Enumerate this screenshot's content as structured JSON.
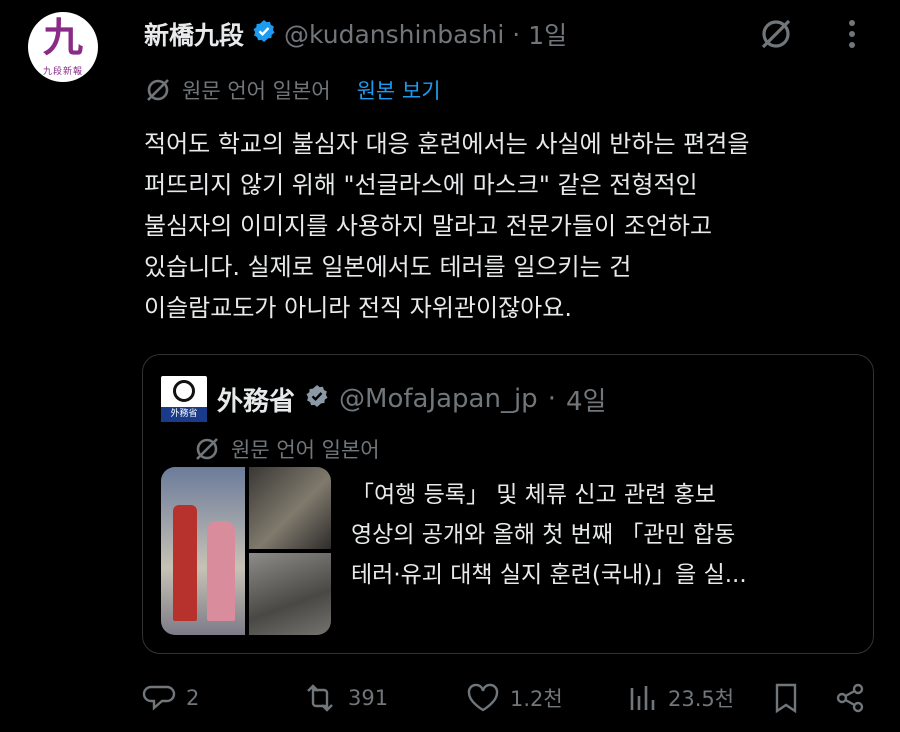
{
  "tweet": {
    "avatar_glyph": "九",
    "avatar_sub": "九段新報",
    "display_name": "新橋九段",
    "handle": "@kudanshinbashi",
    "separator": "·",
    "time": "1일",
    "translate_label": "원문 언어 일본어",
    "translate_link": "원본 보기",
    "body_lines": [
      "적어도 학교의 불심자 대응 훈련에서는 사실에 반하는 편견을",
      "퍼뜨리지 않기 위해 \"선글라스에 마스크\" 같은 전형적인",
      "불심자의 이미지를 사용하지 말라고 전문가들이 조언하고",
      "있습니다. 실제로 일본에서도 테러를 일으키는 건",
      "이슬람교도가 아니라 전직 자위관이잖아요."
    ]
  },
  "quote": {
    "logo_text": "外務省",
    "display_name": "外務省",
    "handle": "@MofaJapan_jp",
    "separator": "·",
    "time": "4일",
    "translate_label": "원문 언어 일본어",
    "text_lines": [
      "「여행 등록」 및 체류 신고 관련 홍보",
      "영상의 공개와 올해 첫 번째 「관민 합동",
      "테러·유괴 대책 실지 훈련(국내)」을 실..."
    ]
  },
  "actions": {
    "replies": "2",
    "reposts": "391",
    "likes": "1.2천",
    "views": "23.5천"
  },
  "colors": {
    "background": "#000000",
    "text": "#e7e9ea",
    "muted": "#71767b",
    "accent": "#1d9bf0",
    "border": "#2f3336"
  },
  "icons": [
    "verified-badge-icon",
    "grok-icon",
    "more-icon",
    "translate-icon",
    "reply-icon",
    "repost-icon",
    "like-icon",
    "views-icon",
    "bookmark-icon",
    "share-icon"
  ]
}
